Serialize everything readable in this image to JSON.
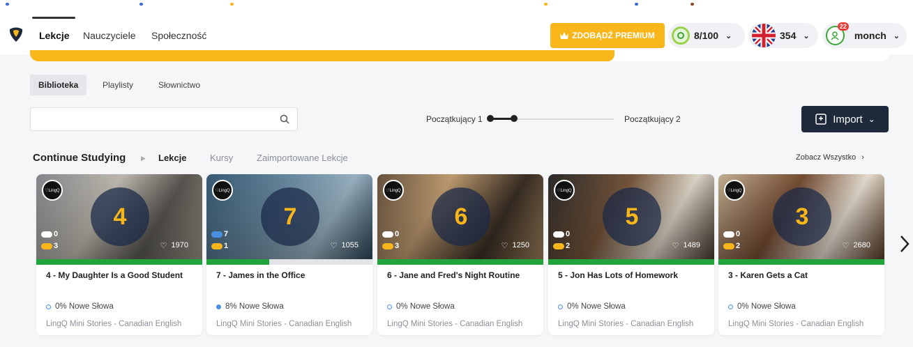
{
  "header": {
    "nav": [
      "Lekcje",
      "Nauczyciele",
      "Społeczność"
    ],
    "premium_label": "ZDOBĄDŹ PREMIUM",
    "daily_goal": "8/100",
    "coins": "354",
    "notifications": "22",
    "username": "monch"
  },
  "progress": {
    "fraction": 0.68
  },
  "library": {
    "tabs": [
      "Biblioteka",
      "Playlisty",
      "Słownictwo"
    ],
    "search_placeholder": "",
    "level_from": "Początkujący 1",
    "level_to": "Początkujący 2",
    "import_label": "Import"
  },
  "continue": {
    "title": "Continue Studying",
    "tabs": [
      "Lekcje",
      "Kursy",
      "Zaimportowane Lekcje"
    ],
    "see_all": "Zobacz Wszystko"
  },
  "cards": [
    {
      "number": "4",
      "blue_count": "0",
      "yellow_count": "3",
      "likes": "1970",
      "title": "4 - My Daughter Is a Good Student",
      "new_words": "0% Nowe Słowa",
      "course": "LingQ Mini Stories - Canadian English",
      "known_fraction": 1.0,
      "new_pct": 0
    },
    {
      "number": "7",
      "blue_count": "7",
      "yellow_count": "1",
      "likes": "1055",
      "title": "7 - James in the Office",
      "new_words": "8% Nowe Słowa",
      "course": "LingQ Mini Stories - Canadian English",
      "known_fraction": 0.38,
      "new_pct": 8
    },
    {
      "number": "6",
      "blue_count": "0",
      "yellow_count": "3",
      "likes": "1250",
      "title": "6 - Jane and Fred's Night Routine",
      "new_words": "0% Nowe Słowa",
      "course": "LingQ Mini Stories - Canadian English",
      "known_fraction": 1.0,
      "new_pct": 0
    },
    {
      "number": "5",
      "blue_count": "0",
      "yellow_count": "2",
      "likes": "1489",
      "title": "5 - Jon Has Lots of Homework",
      "new_words": "0% Nowe Słowa",
      "course": "LingQ Mini Stories - Canadian English",
      "known_fraction": 1.0,
      "new_pct": 0
    },
    {
      "number": "3",
      "blue_count": "0",
      "yellow_count": "2",
      "likes": "2680",
      "title": "3 - Karen Gets a Cat",
      "new_words": "0% Nowe Słowa",
      "course": "LingQ Mini Stories - Canadian English",
      "known_fraction": 1.0,
      "new_pct": 0
    }
  ],
  "colors": {
    "accent": "#f8b61a",
    "known": "#22a33b",
    "dark": "#1e2a3b",
    "blue": "#4a90e2"
  },
  "icons": [
    "lingq-logo-icon",
    "crown-icon",
    "streak-icon",
    "uk-flag-icon",
    "avatar-icon",
    "search-icon",
    "import-icon",
    "chevron-down-icon",
    "chevron-right-icon",
    "heart-icon"
  ]
}
